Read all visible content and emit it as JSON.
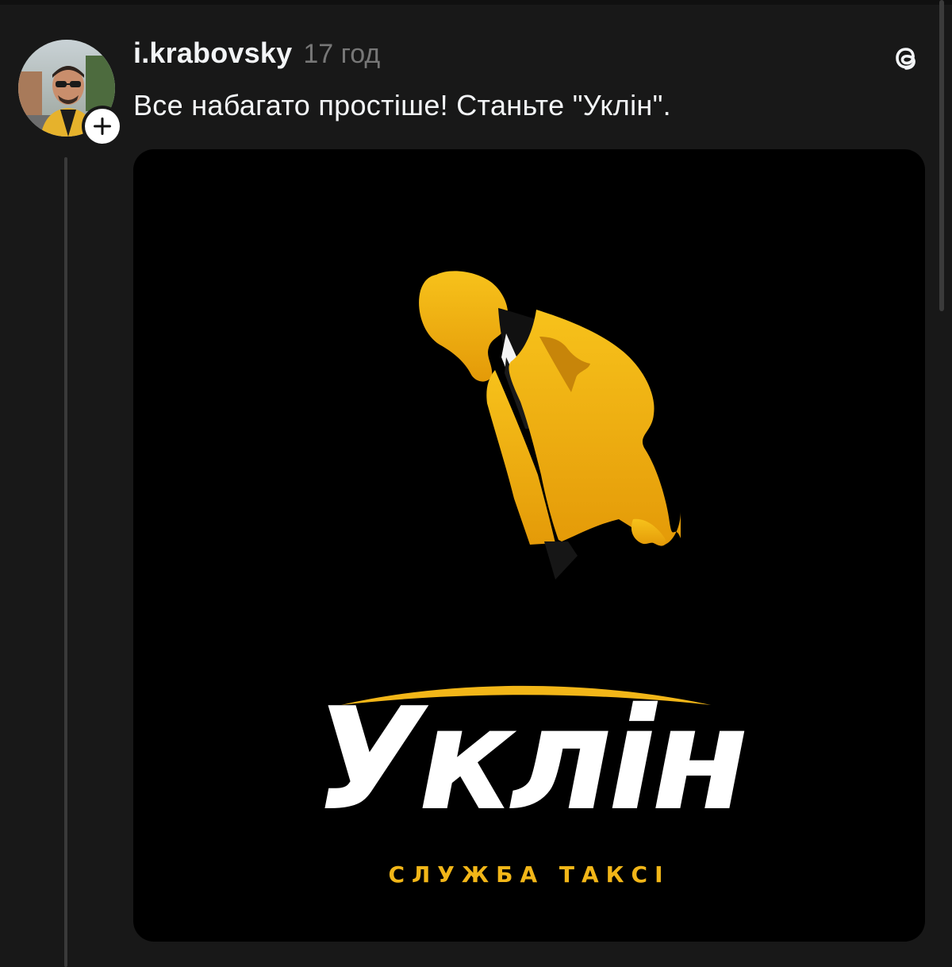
{
  "post": {
    "username": "i.krabovsky",
    "timestamp": "17 год",
    "text": "Все набагато простіше! Станьте \"Уклін\"."
  },
  "icons": {
    "follow": "plus-icon",
    "app": "threads-icon"
  },
  "media": {
    "logo_title": "Уклін",
    "logo_subtitle": "СЛУЖБА ТАКСІ"
  },
  "colors": {
    "background": "#181818",
    "text_primary": "#f3f5f7",
    "text_secondary": "#777777",
    "brand_yellow": "#f2b618"
  }
}
